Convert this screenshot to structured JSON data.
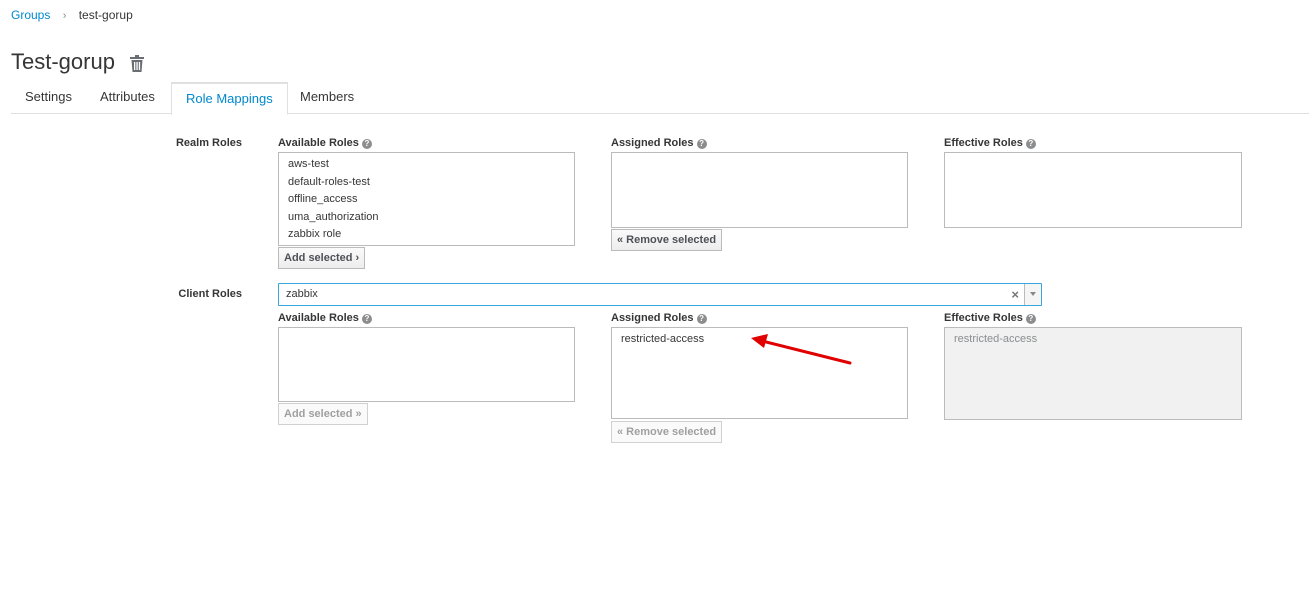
{
  "breadcrumb": {
    "parent": "Groups",
    "separator": "›",
    "current": "test-gorup"
  },
  "page": {
    "title": "Test-gorup",
    "delete_icon": "trash-icon"
  },
  "tabs": [
    {
      "label": "Settings",
      "active": false
    },
    {
      "label": "Attributes",
      "active": false
    },
    {
      "label": "Role Mappings",
      "active": true
    },
    {
      "label": "Members",
      "active": false
    }
  ],
  "realm_roles": {
    "label": "Realm Roles",
    "available": {
      "label": "Available Roles",
      "items": [
        "aws-test",
        "default-roles-test",
        "offline_access",
        "uma_authorization",
        "zabbix role"
      ]
    },
    "assigned": {
      "label": "Assigned Roles",
      "items": []
    },
    "effective": {
      "label": "Effective Roles",
      "items": []
    },
    "add_button": "Add selected ›",
    "remove_button": "« Remove selected"
  },
  "client_roles": {
    "label": "Client Roles",
    "client_select": {
      "value": "zabbix",
      "clear": "×"
    },
    "available": {
      "label": "Available Roles",
      "items": []
    },
    "assigned": {
      "label": "Assigned Roles",
      "items": [
        "restricted-access"
      ]
    },
    "effective": {
      "label": "Effective Roles",
      "items": [
        "restricted-access"
      ]
    },
    "add_button": "Add selected »",
    "remove_button": "« Remove selected"
  },
  "help_icon": "?",
  "colors": {
    "link": "#0088ce",
    "active_tab": "#0088ce",
    "select_border": "#39a5dc",
    "annotation_arrow": "#e00000"
  }
}
